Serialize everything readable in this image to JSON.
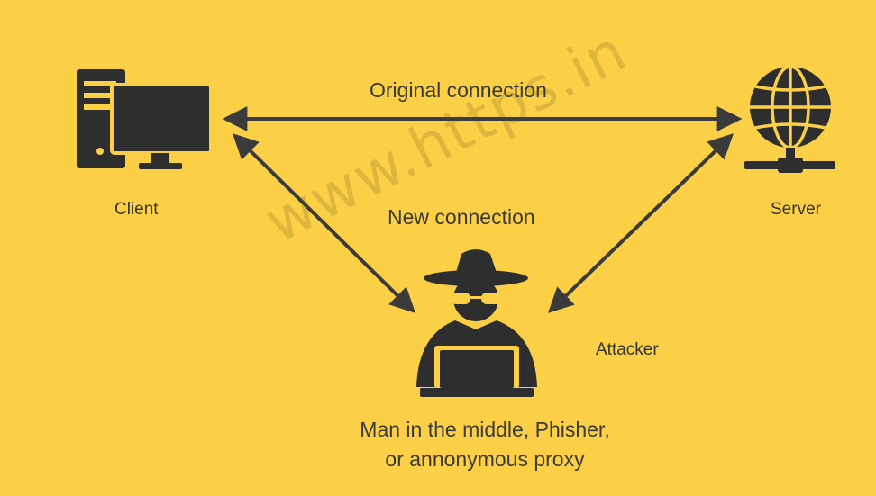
{
  "labels": {
    "client": "Client",
    "server": "Server",
    "attacker": "Attacker",
    "original_connection": "Original connection",
    "new_connection": "New connection",
    "caption_line1": "Man in the middle, Phisher,",
    "caption_line2": "or annonymous proxy"
  },
  "watermark": "www.https.in",
  "colors": {
    "background": "#fbd046",
    "icon": "#2e2e2e",
    "arrow": "#3b3b3b",
    "text": "#333333"
  },
  "icons": {
    "client": "desktop-computer-icon",
    "server": "globe-server-icon",
    "attacker": "hacker-spy-icon"
  }
}
